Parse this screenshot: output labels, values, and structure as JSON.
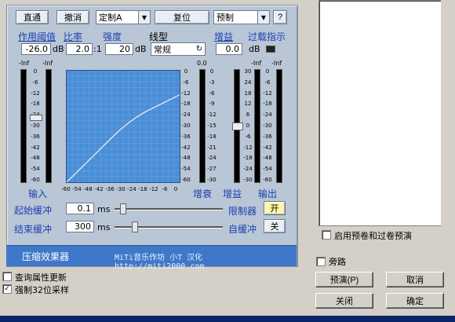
{
  "toolbar": {
    "btn_direct": "直通",
    "btn_undo": "撤消",
    "custom_combo": "定制A",
    "btn_reset": "复位",
    "preset_combo": "预制",
    "btn_help": "?"
  },
  "params": {
    "threshold_label": "作用阈值",
    "threshold_value": "-26.0",
    "threshold_unit": "dB",
    "ratio_label": "比率",
    "ratio_value": "2.0",
    "ratio_suffix": ":1",
    "knee_label": "强度",
    "knee_value": "20",
    "knee_unit": "dB",
    "line_label": "线型",
    "line_value": "常规",
    "gain_label": "增益",
    "gain_value": "0.0",
    "gain_unit": "dB",
    "overload_label": "过载指示"
  },
  "meters": {
    "input_top_left": "-Inf",
    "input_top_right": "-Inf",
    "input_scale": [
      "0",
      "-6",
      "-12",
      "-18",
      "-24",
      "-30",
      "-36",
      "-42",
      "-48",
      "-54",
      "-60"
    ],
    "reduction_top": "0.0",
    "reduction_scale": [
      "0",
      "-3",
      "-6",
      "-9",
      "-12",
      "-15",
      "-18",
      "-21",
      "-24",
      "-27",
      "-30"
    ],
    "gain_scale": [
      "30",
      "24",
      "18",
      "12",
      "6",
      "0",
      "-6",
      "-12",
      "-18",
      "-24",
      "-30"
    ],
    "output_top_left": "-Inf",
    "output_top_right": "-Inf",
    "output_scale": [
      "0",
      "-6",
      "-12",
      "-18",
      "-24",
      "-30",
      "-36",
      "-42",
      "-48",
      "-54",
      "-60"
    ],
    "graph_right_scale": [
      "0",
      "-6",
      "-12",
      "-18",
      "-24",
      "-30",
      "-36",
      "-42",
      "-48",
      "-54",
      "-60"
    ],
    "graph_bottom_scale": [
      "-60",
      "-54",
      "-48",
      "-42",
      "-36",
      "-30",
      "-24",
      "-18",
      "-12",
      "-6",
      "0"
    ],
    "input_label": "输入",
    "reduction_label": "增衰",
    "gain_label": "增益",
    "output_label": "输出"
  },
  "timing": {
    "attack_label": "起始缓冲",
    "attack_value": "0.1",
    "attack_unit": "ms",
    "release_label": "结束缓冲",
    "release_value": "300",
    "release_unit": "ms",
    "limiter_label": "限制器",
    "limiter_btn": "开",
    "auto_label": "自缓冲",
    "auto_btn": "关"
  },
  "footer": {
    "title": "压缩效果器",
    "credit": "MiTi音乐作坊 小T 汉化 http://miti2000.com"
  },
  "right": {
    "preroll_label": "启用预卷和过卷预演",
    "bypass_label": "旁路",
    "preview_btn": "预演(P)",
    "cancel_btn": "取消",
    "close_btn": "关闭",
    "ok_btn": "确定"
  },
  "bottom": {
    "query_label": "查询属性更新",
    "force32_label": "强制32位采样",
    "force32_check": "✓"
  },
  "colors": {
    "panel_bg": "#b9c6d6",
    "label_blue": "#1a3fb0",
    "graph_bg": "#4a8ed6",
    "footer_bar": "#3f78c8"
  }
}
